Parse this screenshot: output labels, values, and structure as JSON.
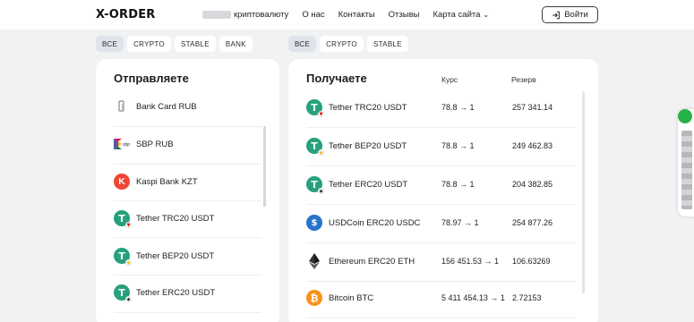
{
  "header": {
    "logo": "X-ORDER",
    "nav": {
      "crypto_suffix": "криптовалюту",
      "about": "О нас",
      "contacts": "Контакты",
      "reviews": "Отзывы",
      "sitemap": "Карта сайта"
    },
    "login_label": "Войти"
  },
  "send": {
    "filters": [
      "ВСЕ",
      "CRYPTO",
      "STABLE",
      "BANK"
    ],
    "active_filter": "ВСЕ",
    "title": "Отправляете",
    "items": [
      {
        "name": "Bank Card RUB",
        "icon": "bank-card-icon"
      },
      {
        "name": "SBP RUB",
        "icon": "sbp-icon"
      },
      {
        "name": "Kaspi Bank KZT",
        "icon": "kaspi-icon"
      },
      {
        "name": "Tether TRC20 USDT",
        "icon": "tether-trc20-icon"
      },
      {
        "name": "Tether BEP20 USDT",
        "icon": "tether-bep20-icon"
      },
      {
        "name": "Tether ERC20 USDT",
        "icon": "tether-erc20-icon"
      }
    ]
  },
  "receive": {
    "filters": [
      "ВСЕ",
      "CRYPTO",
      "STABLE"
    ],
    "active_filter": "ВСЕ",
    "title": "Получаете",
    "col_rate": "Курс",
    "col_reserve": "Резерв",
    "items": [
      {
        "name": "Tether TRC20 USDT",
        "rate": "78.8 → 1",
        "reserve": "257 341.14",
        "icon": "tether-trc20-icon"
      },
      {
        "name": "Tether BEP20 USDT",
        "rate": "78.8 → 1",
        "reserve": "249 462.83",
        "icon": "tether-bep20-icon"
      },
      {
        "name": "Tether ERC20 USDT",
        "rate": "78.8 → 1",
        "reserve": "204 382.85",
        "icon": "tether-erc20-icon"
      },
      {
        "name": "USDCoin ERC20 USDC",
        "rate": "78.97 → 1",
        "reserve": "254 877.26",
        "icon": "usdc-icon"
      },
      {
        "name": "Ethereum ERC20 ETH",
        "rate": "156 451.53 → 1",
        "reserve": "106.63269",
        "icon": "ethereum-icon"
      },
      {
        "name": "Bitcoin BTC",
        "rate": "5 411 454.13 → 1",
        "reserve": "2.72153",
        "icon": "bitcoin-icon"
      }
    ]
  },
  "colors": {
    "tether": "#26a17b",
    "usdc": "#2775ca",
    "bitcoin": "#f7931a",
    "kaspi": "#f14635",
    "chat_widget": "#28b24a"
  }
}
